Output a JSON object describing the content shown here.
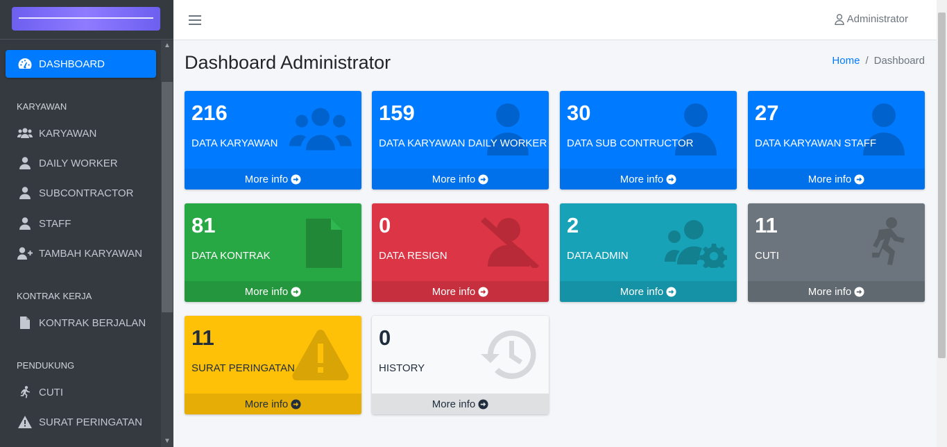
{
  "topbar": {
    "user_label": "Administrator"
  },
  "sidebar": {
    "items": [
      {
        "label": "DASHBOARD"
      },
      {
        "header": "KARYAWAN"
      },
      {
        "label": "KARYAWAN"
      },
      {
        "label": "DAILY WORKER"
      },
      {
        "label": "SUBCONTRACTOR"
      },
      {
        "label": "STAFF"
      },
      {
        "label": "TAMBAH KARYAWAN"
      },
      {
        "header": "KONTRAK KERJA"
      },
      {
        "label": "KONTRAK BERJALAN"
      },
      {
        "header": "PENDUKUNG"
      },
      {
        "label": "CUTI"
      },
      {
        "label": "SURAT PERINGATAN"
      }
    ]
  },
  "page": {
    "title": "Dashboard Administrator",
    "breadcrumb": {
      "home": "Home",
      "current": "Dashboard"
    }
  },
  "boxes": [
    {
      "value": "216",
      "label": "DATA KARYAWAN",
      "more": "More info",
      "color": "#007bff",
      "icon": "users-icon"
    },
    {
      "value": "159",
      "label": "DATA KARYAWAN DAILY WORKER",
      "more": "More info",
      "color": "#007bff",
      "icon": "user-icon"
    },
    {
      "value": "30",
      "label": "DATA SUB CONTRUCTOR",
      "more": "More info",
      "color": "#007bff",
      "icon": "user-icon"
    },
    {
      "value": "27",
      "label": "DATA KARYAWAN STAFF",
      "more": "More info",
      "color": "#007bff",
      "icon": "user-icon"
    },
    {
      "value": "81",
      "label": "DATA KONTRAK",
      "more": "More info",
      "color": "#28a745",
      "icon": "file-icon"
    },
    {
      "value": "0",
      "label": "DATA RESIGN",
      "more": "More info",
      "color": "#dc3545",
      "icon": "user-slash-icon"
    },
    {
      "value": "2",
      "label": "DATA ADMIN",
      "more": "More info",
      "color": "#17a2b8",
      "icon": "users-cog-icon"
    },
    {
      "value": "11",
      "label": "CUTI",
      "more": "More info",
      "color": "#6c757d",
      "icon": "running-icon"
    },
    {
      "value": "11",
      "label": "SURAT PERINGATAN",
      "more": "More info",
      "color": "#ffc107",
      "icon": "warning-icon"
    },
    {
      "value": "0",
      "label": "HISTORY",
      "more": "More info",
      "color": "#f8f9fa",
      "icon": "history-icon"
    }
  ]
}
